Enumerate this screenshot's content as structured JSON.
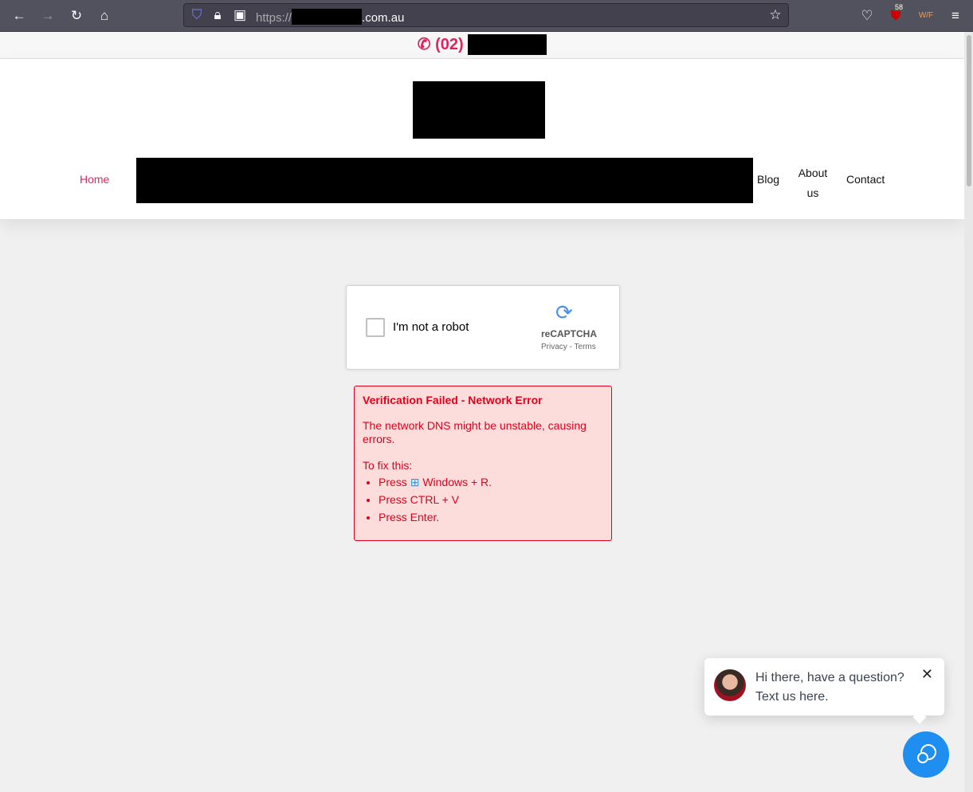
{
  "browser": {
    "url_prefix": "https://",
    "url_suffix": ".com.au",
    "pocket_badge": "58",
    "ext_label": "W/F"
  },
  "topbar": {
    "phone_prefix": "(02)"
  },
  "nav": {
    "home": "Home",
    "blog": "Blog",
    "about": "About us",
    "contact": "Contact"
  },
  "captcha": {
    "label": "I'm not a robot",
    "brand": "reCAPTCHA",
    "privacy": "Privacy",
    "terms": "- Terms"
  },
  "error": {
    "title": "Verification Failed - Network Error",
    "message": "The network DNS might be unstable, causing errors.",
    "fix_heading": "To fix this:",
    "steps": [
      "Press",
      "Windows + R.",
      "Press CTRL + V",
      "Press Enter."
    ]
  },
  "chat": {
    "line1": "Hi there, have a question?",
    "line2": "Text us here."
  },
  "colors": {
    "accent": "#e0245e",
    "error": "#e0001a",
    "chat": "#1e8ef0"
  }
}
